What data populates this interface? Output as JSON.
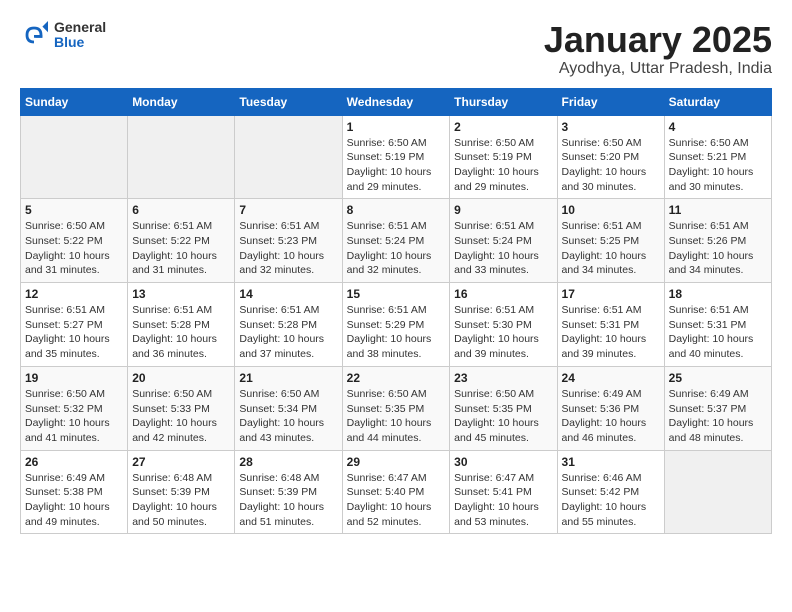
{
  "header": {
    "logo_general": "General",
    "logo_blue": "Blue",
    "title": "January 2025",
    "subtitle": "Ayodhya, Uttar Pradesh, India"
  },
  "calendar": {
    "days_of_week": [
      "Sunday",
      "Monday",
      "Tuesday",
      "Wednesday",
      "Thursday",
      "Friday",
      "Saturday"
    ],
    "weeks": [
      [
        {
          "day": "",
          "info": ""
        },
        {
          "day": "",
          "info": ""
        },
        {
          "day": "",
          "info": ""
        },
        {
          "day": "1",
          "info": "Sunrise: 6:50 AM\nSunset: 5:19 PM\nDaylight: 10 hours and 29 minutes."
        },
        {
          "day": "2",
          "info": "Sunrise: 6:50 AM\nSunset: 5:19 PM\nDaylight: 10 hours and 29 minutes."
        },
        {
          "day": "3",
          "info": "Sunrise: 6:50 AM\nSunset: 5:20 PM\nDaylight: 10 hours and 30 minutes."
        },
        {
          "day": "4",
          "info": "Sunrise: 6:50 AM\nSunset: 5:21 PM\nDaylight: 10 hours and 30 minutes."
        }
      ],
      [
        {
          "day": "5",
          "info": "Sunrise: 6:50 AM\nSunset: 5:22 PM\nDaylight: 10 hours and 31 minutes."
        },
        {
          "day": "6",
          "info": "Sunrise: 6:51 AM\nSunset: 5:22 PM\nDaylight: 10 hours and 31 minutes."
        },
        {
          "day": "7",
          "info": "Sunrise: 6:51 AM\nSunset: 5:23 PM\nDaylight: 10 hours and 32 minutes."
        },
        {
          "day": "8",
          "info": "Sunrise: 6:51 AM\nSunset: 5:24 PM\nDaylight: 10 hours and 32 minutes."
        },
        {
          "day": "9",
          "info": "Sunrise: 6:51 AM\nSunset: 5:24 PM\nDaylight: 10 hours and 33 minutes."
        },
        {
          "day": "10",
          "info": "Sunrise: 6:51 AM\nSunset: 5:25 PM\nDaylight: 10 hours and 34 minutes."
        },
        {
          "day": "11",
          "info": "Sunrise: 6:51 AM\nSunset: 5:26 PM\nDaylight: 10 hours and 34 minutes."
        }
      ],
      [
        {
          "day": "12",
          "info": "Sunrise: 6:51 AM\nSunset: 5:27 PM\nDaylight: 10 hours and 35 minutes."
        },
        {
          "day": "13",
          "info": "Sunrise: 6:51 AM\nSunset: 5:28 PM\nDaylight: 10 hours and 36 minutes."
        },
        {
          "day": "14",
          "info": "Sunrise: 6:51 AM\nSunset: 5:28 PM\nDaylight: 10 hours and 37 minutes."
        },
        {
          "day": "15",
          "info": "Sunrise: 6:51 AM\nSunset: 5:29 PM\nDaylight: 10 hours and 38 minutes."
        },
        {
          "day": "16",
          "info": "Sunrise: 6:51 AM\nSunset: 5:30 PM\nDaylight: 10 hours and 39 minutes."
        },
        {
          "day": "17",
          "info": "Sunrise: 6:51 AM\nSunset: 5:31 PM\nDaylight: 10 hours and 39 minutes."
        },
        {
          "day": "18",
          "info": "Sunrise: 6:51 AM\nSunset: 5:31 PM\nDaylight: 10 hours and 40 minutes."
        }
      ],
      [
        {
          "day": "19",
          "info": "Sunrise: 6:50 AM\nSunset: 5:32 PM\nDaylight: 10 hours and 41 minutes."
        },
        {
          "day": "20",
          "info": "Sunrise: 6:50 AM\nSunset: 5:33 PM\nDaylight: 10 hours and 42 minutes."
        },
        {
          "day": "21",
          "info": "Sunrise: 6:50 AM\nSunset: 5:34 PM\nDaylight: 10 hours and 43 minutes."
        },
        {
          "day": "22",
          "info": "Sunrise: 6:50 AM\nSunset: 5:35 PM\nDaylight: 10 hours and 44 minutes."
        },
        {
          "day": "23",
          "info": "Sunrise: 6:50 AM\nSunset: 5:35 PM\nDaylight: 10 hours and 45 minutes."
        },
        {
          "day": "24",
          "info": "Sunrise: 6:49 AM\nSunset: 5:36 PM\nDaylight: 10 hours and 46 minutes."
        },
        {
          "day": "25",
          "info": "Sunrise: 6:49 AM\nSunset: 5:37 PM\nDaylight: 10 hours and 48 minutes."
        }
      ],
      [
        {
          "day": "26",
          "info": "Sunrise: 6:49 AM\nSunset: 5:38 PM\nDaylight: 10 hours and 49 minutes."
        },
        {
          "day": "27",
          "info": "Sunrise: 6:48 AM\nSunset: 5:39 PM\nDaylight: 10 hours and 50 minutes."
        },
        {
          "day": "28",
          "info": "Sunrise: 6:48 AM\nSunset: 5:39 PM\nDaylight: 10 hours and 51 minutes."
        },
        {
          "day": "29",
          "info": "Sunrise: 6:47 AM\nSunset: 5:40 PM\nDaylight: 10 hours and 52 minutes."
        },
        {
          "day": "30",
          "info": "Sunrise: 6:47 AM\nSunset: 5:41 PM\nDaylight: 10 hours and 53 minutes."
        },
        {
          "day": "31",
          "info": "Sunrise: 6:46 AM\nSunset: 5:42 PM\nDaylight: 10 hours and 55 minutes."
        },
        {
          "day": "",
          "info": ""
        }
      ]
    ]
  }
}
